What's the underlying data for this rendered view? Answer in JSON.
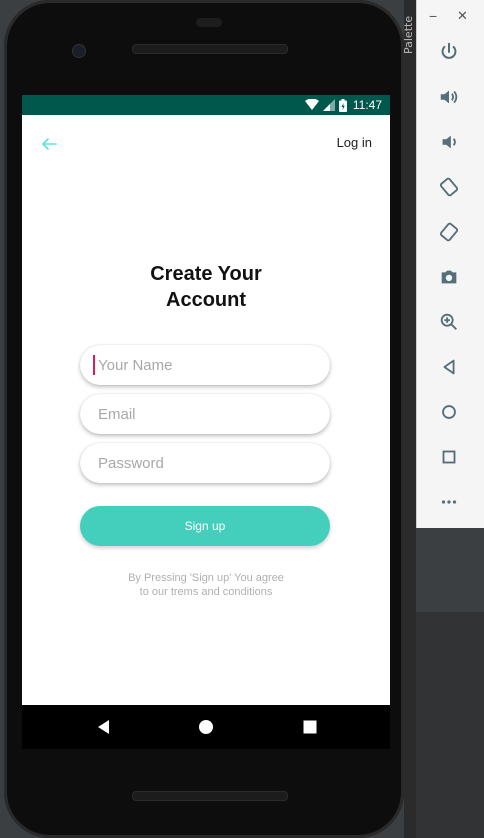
{
  "ide": {
    "palette_label": "Palette"
  },
  "emulator_toolbar": {
    "minimize_glyph": "−",
    "close_glyph": "✕",
    "buttons": [
      "power-icon",
      "volume-up-icon",
      "volume-down-icon",
      "rotate-left-icon",
      "rotate-right-icon",
      "camera-icon",
      "zoom-icon",
      "back-icon",
      "home-icon",
      "overview-icon",
      "more-icon"
    ]
  },
  "status_bar": {
    "time": "11:47",
    "color": "#00574b"
  },
  "header": {
    "login_label": "Log in",
    "back_color": "#5ee3d6"
  },
  "form": {
    "title_line1": "Create Your",
    "title_line2": "Account",
    "name_placeholder": "Your Name",
    "email_placeholder": "Email",
    "password_placeholder": "Password",
    "signup_label": "Sign up",
    "terms_line1": "By Pressing 'Sign up' You agree",
    "terms_line2": "to our trems and conditions"
  },
  "colors": {
    "accent": "#44cfbd",
    "cursor": "#d81b60"
  }
}
